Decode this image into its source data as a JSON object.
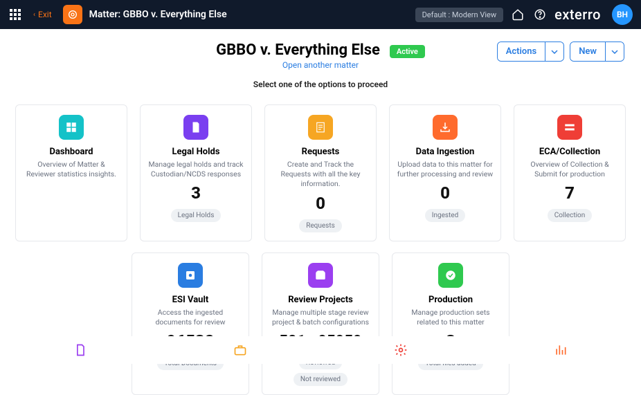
{
  "topbar": {
    "exit_label": "Exit",
    "matter_title": "Matter: GBBO v. Everything Else",
    "view_label": "Default : Modern View",
    "brand_prefix": "e",
    "brand_x": "x",
    "brand_suffix": "terro",
    "avatar_initials": "BH"
  },
  "header": {
    "title": "GBBO v. Everything Else",
    "status": "Active",
    "open_another": "Open another matter",
    "instruction": "Select one of the options to proceed",
    "actions_label": "Actions",
    "new_label": "New"
  },
  "cards": {
    "dashboard": {
      "title": "Dashboard",
      "desc": "Overview of Matter & Reviewer statistics insights."
    },
    "legal_holds": {
      "title": "Legal Holds",
      "desc": "Manage legal holds and track Custodian/NCDS responses",
      "count": "3",
      "pill": "Legal Holds"
    },
    "requests": {
      "title": "Requests",
      "desc": "Create and Track the Requests with all the key information.",
      "count": "0",
      "pill": "Requests"
    },
    "ingestion": {
      "title": "Data Ingestion",
      "desc": "Upload data to this matter for further processing and review",
      "count": "0",
      "pill": "Ingested"
    },
    "eca": {
      "title": "ECA/Collection",
      "desc": "Overview of Collection & Submit for production",
      "count": "7",
      "pill": "Collection"
    },
    "esi": {
      "title": "ESI Vault",
      "desc": "Access the ingested documents for review",
      "count": "96532",
      "pill": "Total Documents"
    },
    "review": {
      "title": "Review Projects",
      "desc": "Manage multiple stage review project & batch configurations",
      "count1": "501",
      "count2": "95959",
      "pill1": "Reviewed",
      "pill2": "Not reviewed"
    },
    "production": {
      "title": "Production",
      "desc": "Manage production sets related to this matter",
      "count": "3",
      "pill": "Total files added"
    }
  }
}
